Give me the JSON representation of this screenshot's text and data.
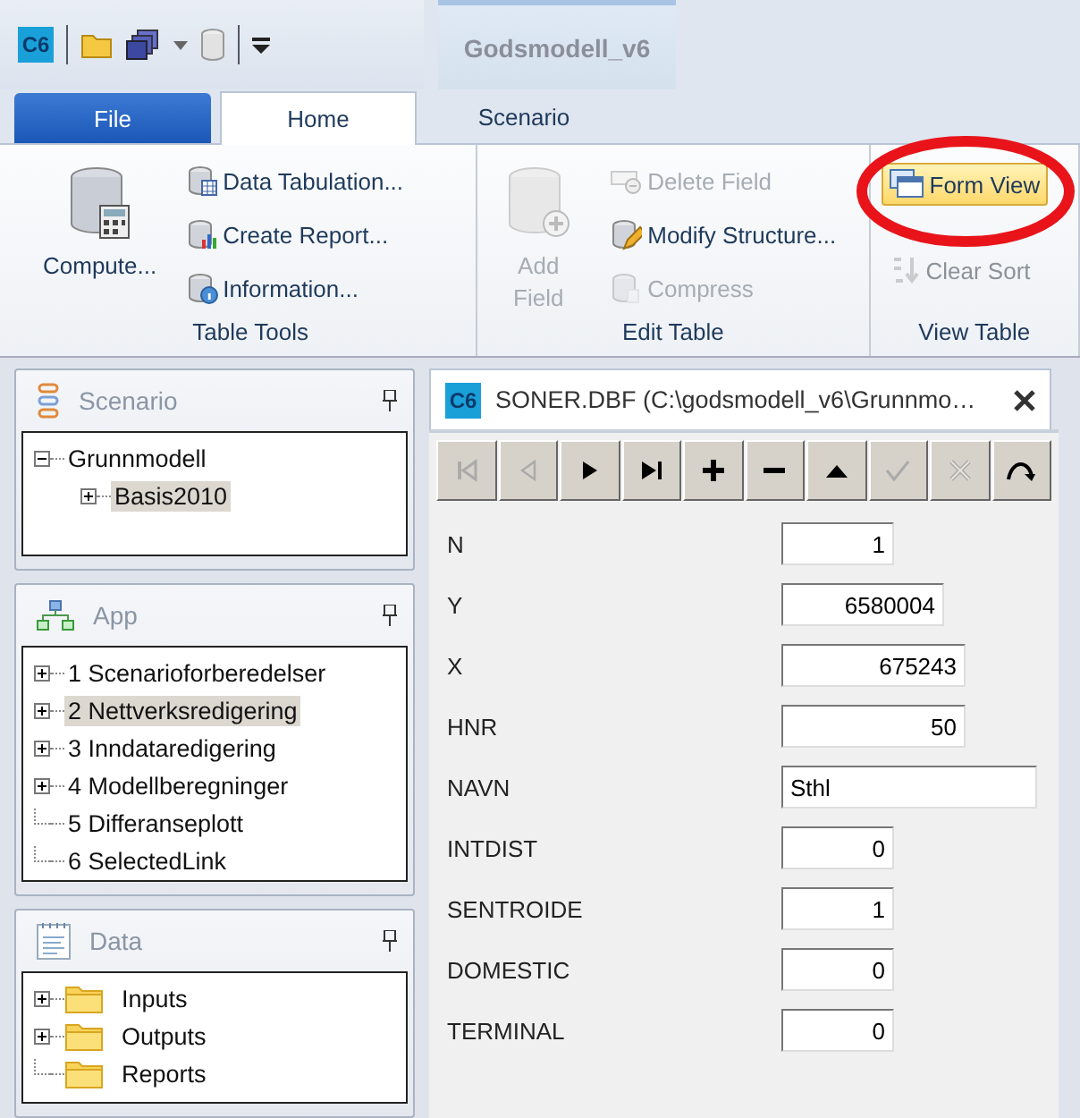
{
  "quick_access": {
    "logo": "C6"
  },
  "ribbon": {
    "context_title": "Godsmodell_v6",
    "tabs": [
      {
        "label": "File",
        "kind": "file",
        "selected": false
      },
      {
        "label": "Home",
        "kind": "tab",
        "selected": true
      },
      {
        "label": "Scenario",
        "kind": "context",
        "selected": false
      }
    ],
    "groups": [
      {
        "label": "Table Tools",
        "large": [
          {
            "label": "Compute...",
            "kind": "compute",
            "disabled": false
          }
        ],
        "small": [
          {
            "label": "Data Tabulation...",
            "kind": "tabulate",
            "disabled": false
          },
          {
            "label": "Create Report...",
            "kind": "report",
            "disabled": false
          },
          {
            "label": "Information...",
            "kind": "info",
            "disabled": false
          }
        ]
      },
      {
        "label": "Edit Table",
        "large": [
          {
            "label": "Add Field",
            "kind": "addfield",
            "disabled": true
          }
        ],
        "small": [
          {
            "label": "Delete Field",
            "kind": "delfield",
            "disabled": true
          },
          {
            "label": "Modify Structure...",
            "kind": "modify",
            "disabled": false
          },
          {
            "label": "Compress",
            "kind": "compress",
            "disabled": true
          }
        ]
      },
      {
        "label": "View Table",
        "small": [
          {
            "label": "Form View",
            "kind": "formview",
            "disabled": false,
            "selected": true,
            "circled": true
          },
          {
            "label": "Clear Sort",
            "kind": "sort",
            "disabled": true,
            "selected": false
          }
        ]
      }
    ]
  },
  "panels": [
    {
      "title": "Scenario",
      "kind": "scenario",
      "items": [
        {
          "label": "Grunnmodell",
          "expanded": true,
          "selected": false,
          "children": [
            {
              "label": "Basis2010",
              "expanded": false,
              "selected": true
            }
          ]
        }
      ]
    },
    {
      "title": "App",
      "kind": "app",
      "items": [
        {
          "label": "1 Scenarioforberedelser",
          "expanded": false,
          "selected": false
        },
        {
          "label": "2 Nettverksredigering",
          "expanded": false,
          "selected": true
        },
        {
          "label": "3 Inndataredigering",
          "expanded": false,
          "selected": false
        },
        {
          "label": "4 Modellberegninger",
          "expanded": false,
          "selected": false
        },
        {
          "label": "5 Differanseplott",
          "selected": false
        },
        {
          "label": "6 SelectedLink",
          "selected": false
        }
      ]
    },
    {
      "title": "Data",
      "kind": "data",
      "items": [
        {
          "label": "Inputs",
          "kind": "folder",
          "expanded": false,
          "selected": false
        },
        {
          "label": "Outputs",
          "kind": "folder",
          "expanded": false,
          "selected": false
        },
        {
          "label": "Reports",
          "kind": "folder",
          "selected": false
        }
      ]
    }
  ],
  "document": {
    "logo": "C6",
    "title": "SONER.DBF (C:\\godsmodell_v6\\Grunnmo…",
    "toolbar": [
      {
        "kind": "first",
        "disabled": true
      },
      {
        "kind": "prev",
        "disabled": true
      },
      {
        "kind": "next",
        "disabled": false
      },
      {
        "kind": "last",
        "disabled": false
      },
      {
        "kind": "insert",
        "disabled": false
      },
      {
        "kind": "delete",
        "disabled": false
      },
      {
        "kind": "up",
        "disabled": false
      },
      {
        "kind": "post",
        "disabled": true
      },
      {
        "kind": "cancel",
        "disabled": true
      },
      {
        "kind": "refresh",
        "disabled": false
      }
    ],
    "fields": [
      {
        "label": "N",
        "value": "1",
        "kind": "number"
      },
      {
        "label": "Y",
        "value": "6580004",
        "kind": "number"
      },
      {
        "label": "X",
        "value": "675243",
        "kind": "number"
      },
      {
        "label": "HNR",
        "value": "50",
        "kind": "number"
      },
      {
        "label": "NAVN",
        "value": "Sthl",
        "kind": "text"
      },
      {
        "label": "INTDIST",
        "value": "0",
        "kind": "number"
      },
      {
        "label": "SENTROIDE",
        "value": "1",
        "kind": "number"
      },
      {
        "label": "DOMESTIC",
        "value": "0",
        "kind": "number"
      },
      {
        "label": "TERMINAL",
        "value": "0",
        "kind": "number"
      }
    ]
  }
}
